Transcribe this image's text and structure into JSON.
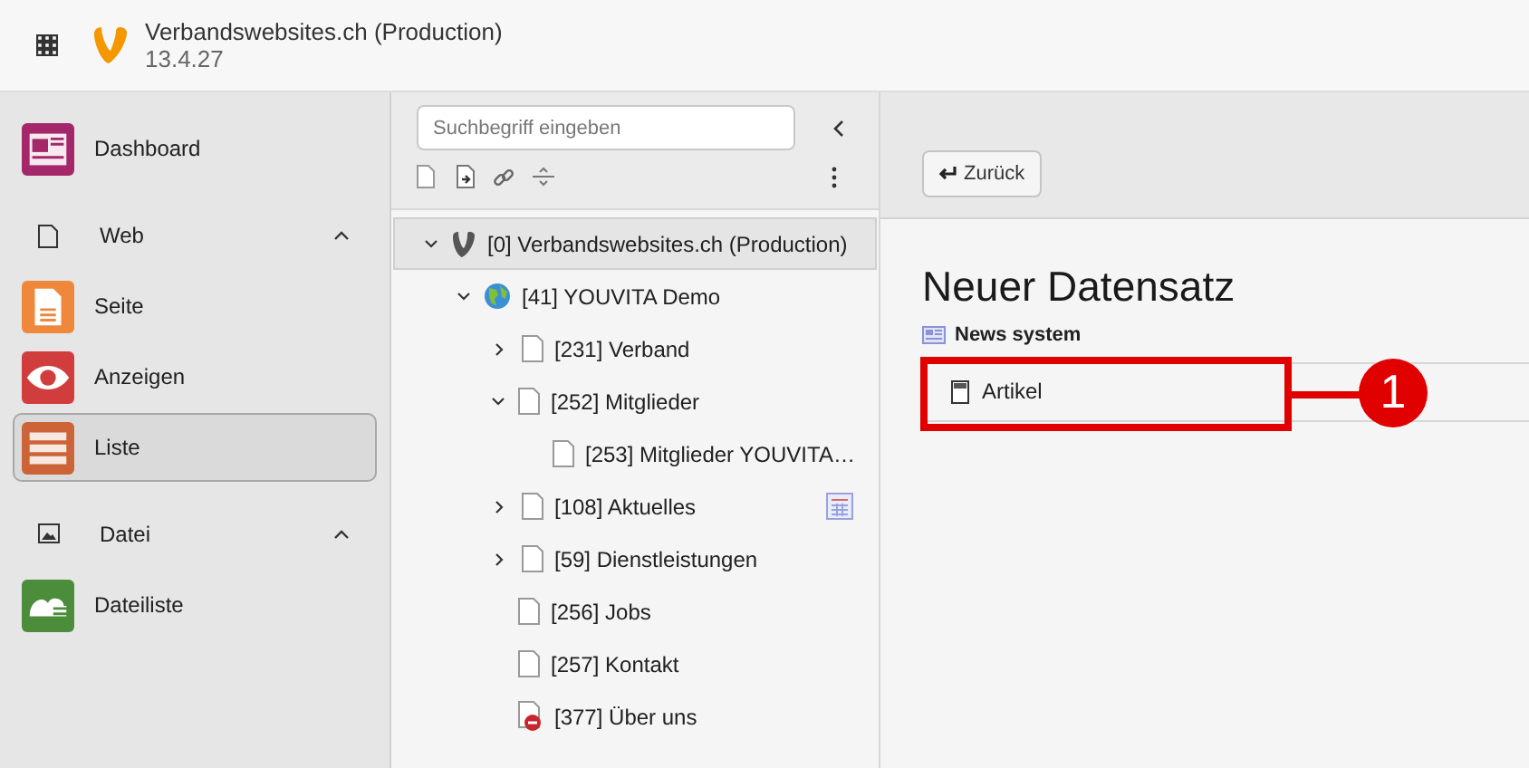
{
  "topbar": {
    "site_name": "Verbandswebsites.ch (Production)",
    "version": "13.4.27"
  },
  "sidebar": {
    "items": [
      {
        "kind": "module",
        "label": "Dashboard",
        "color": "#a4276a",
        "selected": false
      },
      {
        "kind": "group",
        "label": "Web",
        "expanded": true
      },
      {
        "kind": "module",
        "label": "Seite",
        "color": "#f0883c",
        "selected": false
      },
      {
        "kind": "module",
        "label": "Anzeigen",
        "color": "#d13d3d",
        "selected": false
      },
      {
        "kind": "module",
        "label": "Liste",
        "color": "#cc6437",
        "selected": true
      },
      {
        "kind": "group",
        "label": "Datei",
        "expanded": true
      },
      {
        "kind": "module",
        "label": "Dateiliste",
        "color": "#4c8d3b",
        "selected": false
      }
    ]
  },
  "tree": {
    "search": {
      "placeholder": "Suchbegriff eingeben"
    },
    "nodes": [
      {
        "kind": "root",
        "label": "[0] Verbandswebsites.ch (Production)",
        "expanded": true,
        "selected": true,
        "children": [
          {
            "kind": "globe",
            "label": "[41] YOUVITA Demo",
            "expanded": true,
            "selected": false,
            "children": [
              {
                "kind": "page",
                "label": "[231] Verband",
                "expanded": false,
                "selected": false
              },
              {
                "kind": "page",
                "label": "[252] Mitglieder",
                "expanded": true,
                "selected": false,
                "children": [
                  {
                    "kind": "page",
                    "label": "[253] Mitglieder YOUVITA…",
                    "selected": false
                  }
                ]
              },
              {
                "kind": "page",
                "label": "[108] Aktuelles",
                "expanded": false,
                "selected": false,
                "badge": true
              },
              {
                "kind": "page",
                "label": "[59] Dienstleistungen",
                "expanded": false,
                "selected": false
              },
              {
                "kind": "page",
                "label": "[256] Jobs",
                "selected": false
              },
              {
                "kind": "page",
                "label": "[257] Kontakt",
                "selected": false
              },
              {
                "kind": "hidden-page",
                "label": "[377] Über uns",
                "selected": false
              }
            ]
          }
        ]
      }
    ]
  },
  "content": {
    "back_button": "Zurück",
    "title": "Neuer Datensatz",
    "section": "News system",
    "records": [
      {
        "label": "Artikel",
        "highlighted": true,
        "callout": "1"
      }
    ]
  }
}
